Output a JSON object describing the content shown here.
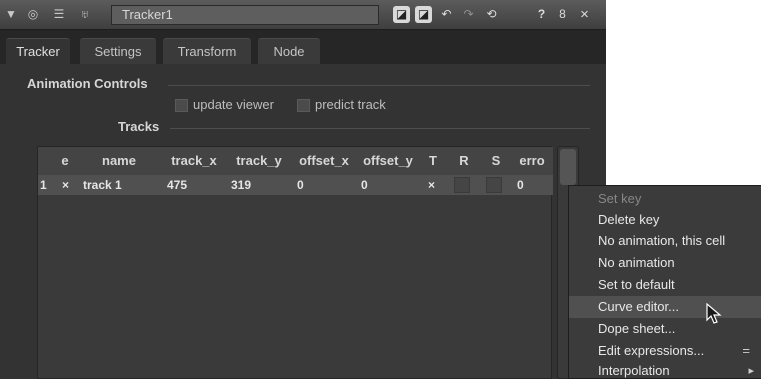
{
  "window": {
    "node_name": "Tracker1",
    "left_icons": [
      "collapse-triangle-icon",
      "circle-icon",
      "centipede-icon",
      "bookmark-icon"
    ],
    "right_icons": [
      "box-icon-1",
      "box-icon-2",
      "undo-icon",
      "redo-icon",
      "reset-icon"
    ],
    "help_label": "?",
    "float_label": "8",
    "close_label": "×"
  },
  "tabs": [
    {
      "label": "Tracker",
      "active": true
    },
    {
      "label": "Settings",
      "active": false
    },
    {
      "label": "Transform",
      "active": false
    },
    {
      "label": "Node",
      "active": false
    }
  ],
  "animation_controls": {
    "title": "Animation Controls",
    "update_viewer_label": "update viewer",
    "predict_track_label": "predict track"
  },
  "tracks": {
    "title": "Tracks",
    "columns": [
      "e",
      "name",
      "track_x",
      "track_y",
      "offset_x",
      "offset_y",
      "T",
      "R",
      "S",
      "error"
    ],
    "header_display": [
      "e",
      "name",
      "track_x",
      "track_y",
      "offset_x",
      "offset_y",
      "T",
      "R",
      "S",
      "erro"
    ],
    "rows": [
      {
        "index": "1",
        "e": "×",
        "name": "track 1",
        "track_x": "475",
        "track_y": "319",
        "offset_x": "0",
        "offset_y": "0",
        "T": "×",
        "R": "",
        "S": "",
        "error": "0"
      }
    ]
  },
  "context_menu": {
    "items": [
      {
        "label": "Set key",
        "disabled": true
      },
      {
        "label": "Delete key"
      },
      {
        "label": "No animation, this cell"
      },
      {
        "label": "No animation"
      },
      {
        "label": "Set to default"
      },
      {
        "label": "Curve editor...",
        "selected": true
      },
      {
        "label": "Dope sheet..."
      },
      {
        "label": "Edit expressions...",
        "suffix": "="
      },
      {
        "label": "Interpolation",
        "submenu": true
      }
    ]
  }
}
